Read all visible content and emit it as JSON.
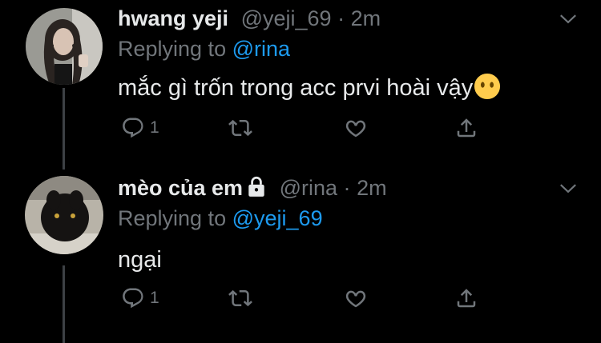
{
  "theme": {
    "background": "#000000",
    "text_primary": "#e7e9ea",
    "text_secondary": "#71767b",
    "accent": "#1d9bf0",
    "thread_line": "#3d4145"
  },
  "tweets": [
    {
      "display_name": "hwang yeji",
      "handle": "@yeji_69",
      "dot": "·",
      "timestamp": "2m",
      "replying_prefix": "Replying to",
      "replying_to": "@rina",
      "text": "mắc gì trốn trong acc prvi hoài vậy",
      "emoji": "no-mouth-face-emoji",
      "protected": false,
      "reply_count": "1",
      "icons": {
        "reply": "reply-icon",
        "retweet": "retweet-icon",
        "like": "heart-icon",
        "share": "share-icon",
        "menu": "chevron-down-icon"
      }
    },
    {
      "display_name": "mèo của em",
      "handle": "@rina",
      "dot": "·",
      "timestamp": "2m",
      "replying_prefix": "Replying to",
      "replying_to": "@yeji_69",
      "text": "ngại",
      "protected": true,
      "reply_count": "1",
      "icons": {
        "reply": "reply-icon",
        "retweet": "retweet-icon",
        "like": "heart-icon",
        "share": "share-icon",
        "menu": "chevron-down-icon",
        "protected": "lock-icon"
      }
    }
  ]
}
